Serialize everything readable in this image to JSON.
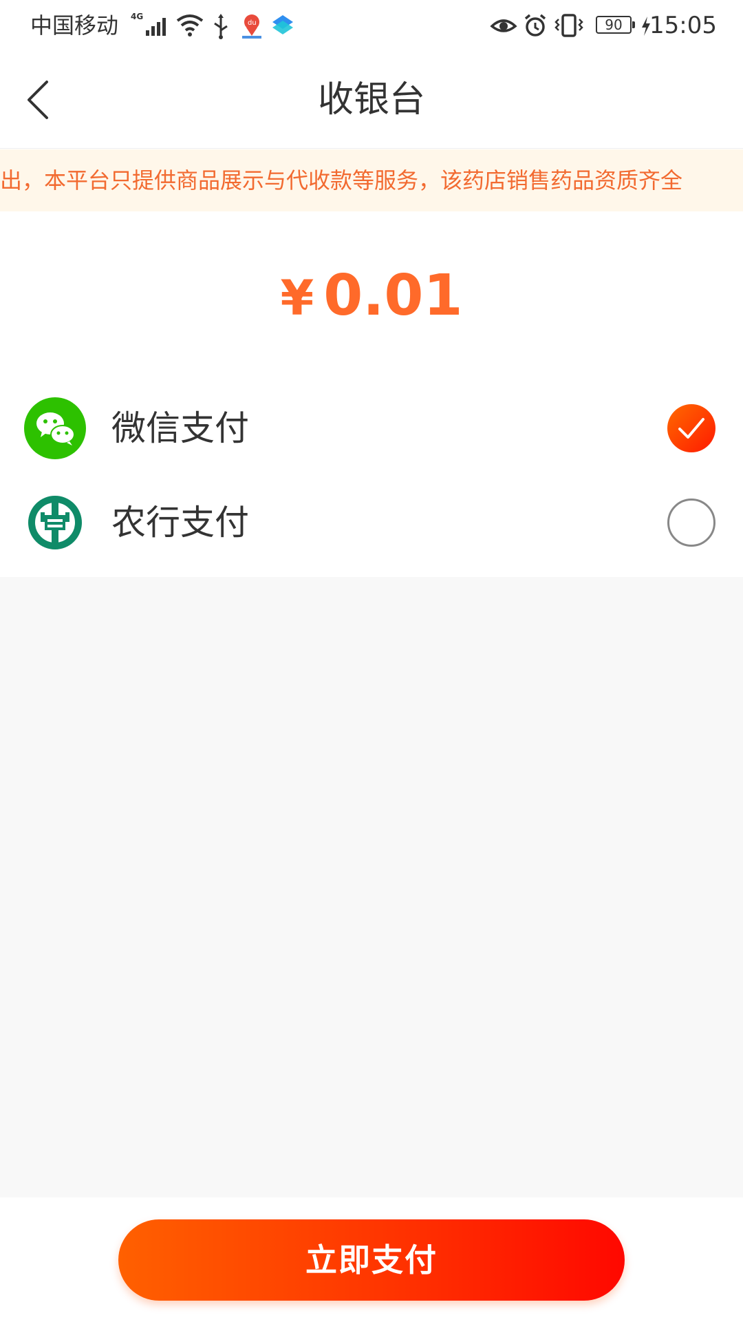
{
  "status_bar": {
    "carrier": "中国移动",
    "network": "4G",
    "battery": "90",
    "time": "15:05",
    "icons": [
      "signal-icon",
      "wifi-icon",
      "usb-icon",
      "baidu-map-icon",
      "app-icon",
      "eye-icon",
      "alarm-icon",
      "vibrate-icon",
      "battery-icon",
      "charging-icon"
    ]
  },
  "nav": {
    "back_icon": "chevron-left-icon",
    "title": "收银台"
  },
  "notice": {
    "text": "出，本平台只提供商品展示与代收款等服务，该药店销售药品资质齐全"
  },
  "amount": {
    "symbol": "¥",
    "value": "0.01"
  },
  "payment_methods": [
    {
      "label": "微信支付",
      "icon": "wechat-icon",
      "selected": true
    },
    {
      "label": "农行支付",
      "icon": "abc-bank-icon",
      "selected": false
    }
  ],
  "pay_button": {
    "label": "立即支付"
  },
  "colors": {
    "accent": "#ff6a2a",
    "notice_bg": "#fff7ea",
    "notice_text": "#f26a30",
    "wechat_green": "#2dc100",
    "abc_green": "#0f8b68"
  }
}
